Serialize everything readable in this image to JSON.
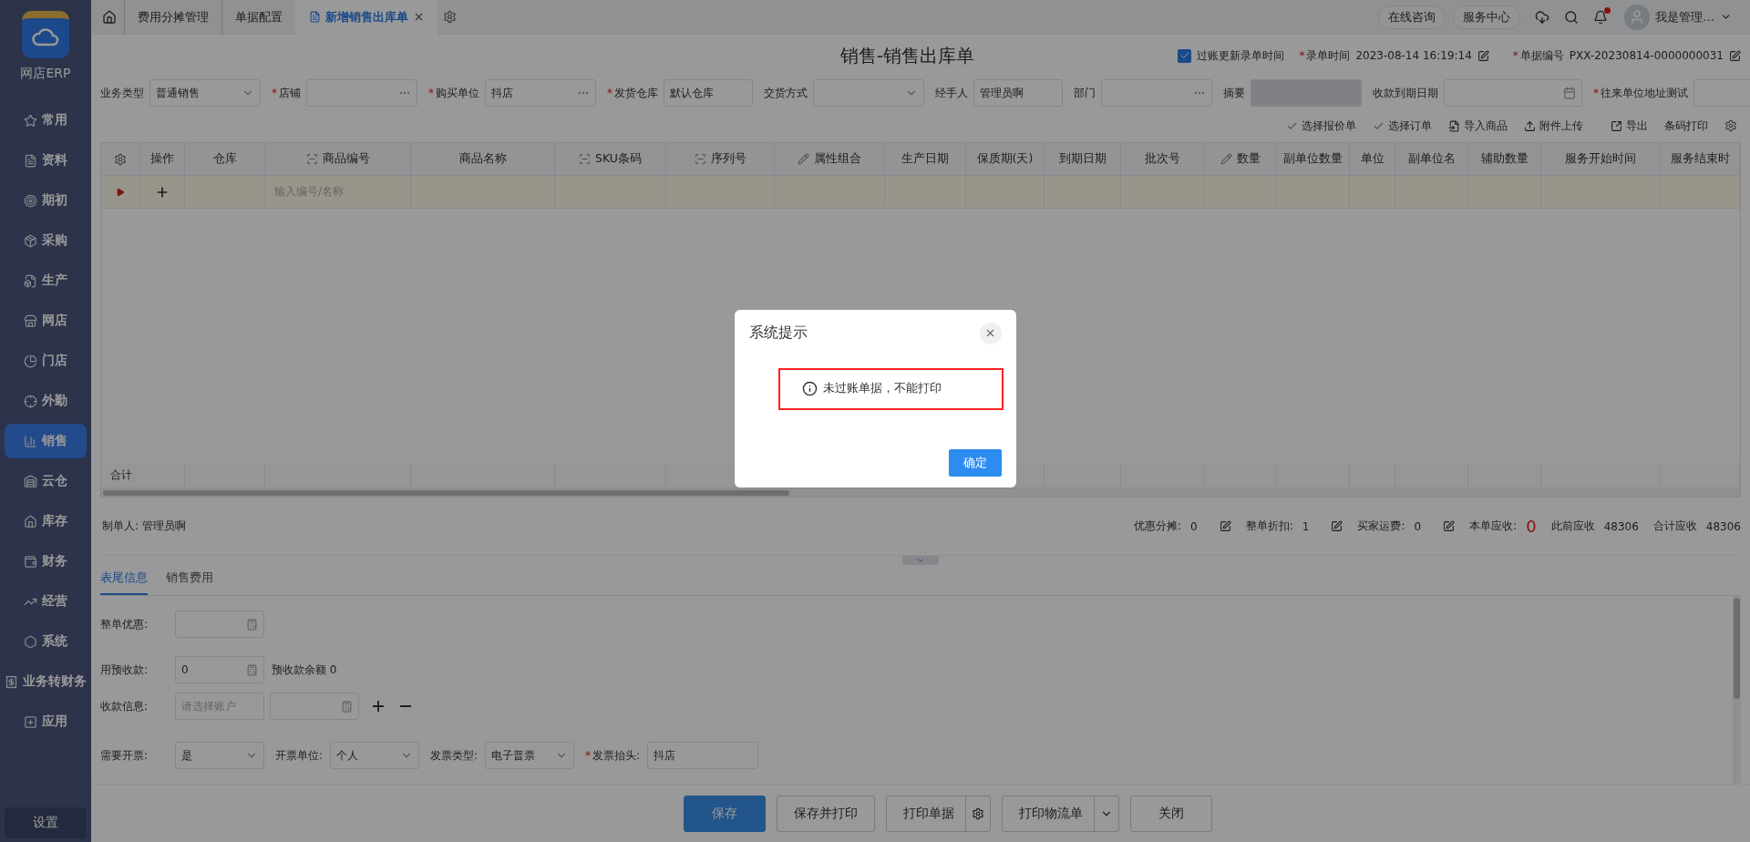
{
  "required_mark": "*",
  "sidebar": {
    "brand": "网店ERP",
    "items": [
      {
        "label": "常用",
        "selected": false
      },
      {
        "label": "资料",
        "selected": false
      },
      {
        "label": "期初",
        "selected": false
      },
      {
        "label": "采购",
        "selected": false
      },
      {
        "label": "生产",
        "selected": false
      },
      {
        "label": "网店",
        "selected": false
      },
      {
        "label": "门店",
        "selected": false
      },
      {
        "label": "外勤",
        "selected": false
      },
      {
        "label": "销售",
        "selected": true
      },
      {
        "label": "云仓",
        "selected": false
      },
      {
        "label": "库存",
        "selected": false
      },
      {
        "label": "财务",
        "selected": false
      },
      {
        "label": "经营",
        "selected": false
      },
      {
        "label": "系统",
        "selected": false
      },
      {
        "label": "业务转财务",
        "selected": false
      },
      {
        "label": "应用",
        "selected": false
      }
    ],
    "settings": "设置"
  },
  "tabs": [
    {
      "label": "费用分摊管理",
      "selected": false
    },
    {
      "label": "单据配置",
      "selected": false
    },
    {
      "label": "新增销售出库单",
      "selected": true
    }
  ],
  "header_links": [
    "在线咨询",
    "服务中心"
  ],
  "notifications": {
    "unread": true
  },
  "user": {
    "name": "我是管理…"
  },
  "page": {
    "title": "销售-销售出库单",
    "update_time": {
      "label": "过账更新录单时间",
      "checked": true
    },
    "entry_time": {
      "label": "录单时间",
      "required": true,
      "value": "2023-08-14 16:19:14"
    },
    "doc_no": {
      "label": "单据编号",
      "required": true,
      "value": "PXX-20230814-0000000031"
    }
  },
  "fields": [
    {
      "label": "业务类型",
      "required": false,
      "kind": "select",
      "value": "普通销售",
      "disabled": false
    },
    {
      "label": "店铺",
      "required": true,
      "kind": "lookup",
      "disabled": false
    },
    {
      "label": "购买单位",
      "required": true,
      "kind": "lookup",
      "value": "抖店",
      "disabled": false
    },
    {
      "label": "发货仓库",
      "required": true,
      "kind": "text",
      "value": "默认仓库",
      "disabled": false
    },
    {
      "label": "交货方式",
      "required": false,
      "kind": "select",
      "disabled": false
    },
    {
      "label": "经手人",
      "required": false,
      "kind": "text",
      "value": "管理员啊",
      "disabled": false
    },
    {
      "label": "部门",
      "required": false,
      "kind": "lookup",
      "disabled": false
    },
    {
      "label": "摘要",
      "required": false,
      "kind": "wide",
      "disabled": true
    },
    {
      "label": "收款到期日期",
      "required": false,
      "kind": "date",
      "disabled": false
    },
    {
      "label": "往来单位地址测试",
      "required": true,
      "kind": "text",
      "disabled": false
    }
  ],
  "toolbar": [
    {
      "label": "选择报价单",
      "kind": "check"
    },
    {
      "label": "选择订单",
      "kind": "check"
    },
    {
      "label": "导入商品",
      "kind": "import"
    },
    {
      "label": "附件上传",
      "kind": "upload"
    },
    {
      "label": "导出",
      "kind": "export"
    },
    {
      "label": "条码打印",
      "kind": "plain"
    }
  ],
  "table": {
    "columns": [
      {
        "label": "操作",
        "kind": "plain"
      },
      {
        "label": "仓库",
        "kind": "plain"
      },
      {
        "label": "商品编号",
        "kind": "scan"
      },
      {
        "label": "商品名称",
        "kind": "plain"
      },
      {
        "label": "SKU条码",
        "kind": "scan"
      },
      {
        "label": "序列号",
        "kind": "scan"
      },
      {
        "label": "属性组合",
        "kind": "edit"
      },
      {
        "label": "生产日期",
        "kind": "plain"
      },
      {
        "label": "保质期(天)",
        "kind": "plain"
      },
      {
        "label": "到期日期",
        "kind": "plain"
      },
      {
        "label": "批次号",
        "kind": "plain"
      },
      {
        "label": "数量",
        "kind": "edit"
      },
      {
        "label": "副单位数量",
        "kind": "plain"
      },
      {
        "label": "单位",
        "kind": "plain"
      },
      {
        "label": "副单位名",
        "kind": "plain"
      },
      {
        "label": "辅助数量",
        "kind": "plain"
      },
      {
        "label": "服务开始时间",
        "kind": "plain"
      },
      {
        "label": "服务结束时",
        "kind": "plain"
      }
    ],
    "new_row": {
      "placeholder": "输入编号/名称"
    },
    "footer": "合计"
  },
  "creator": {
    "label": "制单人:",
    "value": "管理员啊"
  },
  "summary": [
    {
      "label": "优惠分摊:",
      "value": "0",
      "kind": "editable"
    },
    {
      "label": "整单折扣:",
      "value": "1",
      "kind": "editable"
    },
    {
      "label": "买家运费:",
      "value": "0",
      "kind": "editable"
    },
    {
      "label": "本单应收:",
      "value": "0",
      "kind": "highlight"
    },
    {
      "label": "此前应收",
      "value": "48306",
      "kind": "plain"
    },
    {
      "label": "合计应收",
      "value": "48306",
      "kind": "plain"
    }
  ],
  "bottom_tabs": [
    {
      "label": "表尾信息",
      "selected": true
    },
    {
      "label": "销售费用",
      "selected": false
    }
  ],
  "footer_rows": [
    {
      "items": [
        {
          "label": "整单优惠:",
          "required": false,
          "kind": "calc"
        }
      ]
    },
    {
      "items": [
        {
          "label": "用预收款:",
          "required": false,
          "kind": "calc",
          "value": "0"
        }
      ],
      "note": "预收款余额 0"
    },
    {
      "items": [
        {
          "label": "收款信息:",
          "required": false,
          "kind": "text",
          "placeholder": "请选择账户"
        },
        {
          "kind": "calc"
        }
      ],
      "add_remove": true
    },
    {
      "items": [
        {
          "label": "需要开票:",
          "required": false,
          "kind": "select",
          "value": "是"
        },
        {
          "label": "开票单位:",
          "required": false,
          "kind": "select",
          "value": "个人"
        },
        {
          "label": "发票类型:",
          "required": false,
          "kind": "select",
          "value": "电子普票"
        },
        {
          "label": "发票抬头:",
          "required": true,
          "kind": "text",
          "value": "抖店"
        }
      ]
    }
  ],
  "actions": [
    {
      "label": "保存",
      "kind": "primary"
    },
    {
      "label": "保存并打印",
      "kind": "default"
    },
    {
      "label": "打印单据",
      "kind": "settings"
    },
    {
      "label": "打印物流单",
      "kind": "dropdown"
    },
    {
      "label": "关闭",
      "kind": "default"
    }
  ],
  "dialog": {
    "title": "系统提示",
    "message": "未过账单据，不能打印",
    "highlighted": true,
    "button": "确定"
  }
}
